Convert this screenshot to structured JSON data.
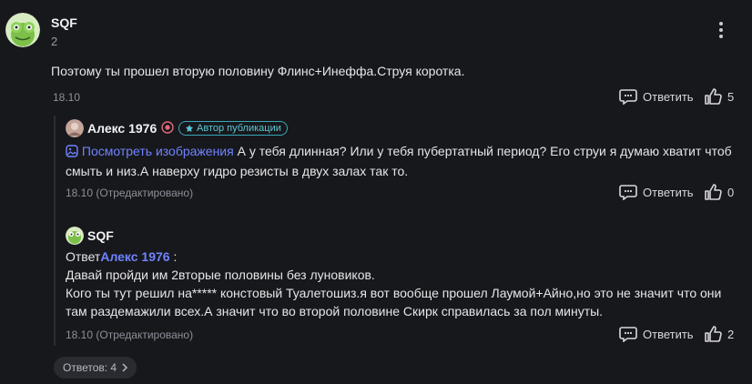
{
  "main_comment": {
    "author": "SQF",
    "level": "2",
    "text": "Поэтому ты прошел вторую половину Флинс+Инеффа.Струя коротка.",
    "date": "18.10",
    "reply_label": "Ответить",
    "likes": "5"
  },
  "reply1": {
    "author": "Алекс 1976",
    "badge": "Автор публикации",
    "view_images": "Посмотреть изображения",
    "text_line1": " А у тебя длинная? Или у тебя пубертатный период? Его струи я думаю хватит чтоб",
    "text_line2": "смыть и низ.А наверху гидро резисты в двух залах так то.",
    "date": "18.10 (Отредактировано)",
    "reply_label": "Ответить",
    "likes": "0"
  },
  "reply2": {
    "author": "SQF",
    "reply_prefix": "Ответ",
    "reply_to": "Алекс 1976",
    "reply_suffix": " :",
    "line1": "Давай пройди им 2вторые половины без луновиков.",
    "line2": "Кого ты тут решил на***** констовый Туалетошиз.я вот вообще прошел Лаумой+Айно,но это не значит что они",
    "line3": "там раздемажили всех.А значит что во второй половине Скирк справилась за пол минуты.",
    "date": "18.10 (Отредактировано)",
    "reply_label": "Ответить",
    "likes": "2"
  },
  "replies_button": {
    "label": "Ответов: 4"
  },
  "colors": {
    "background": "#17181c",
    "link": "#6f83ff",
    "badge": "#5ec5d3"
  }
}
